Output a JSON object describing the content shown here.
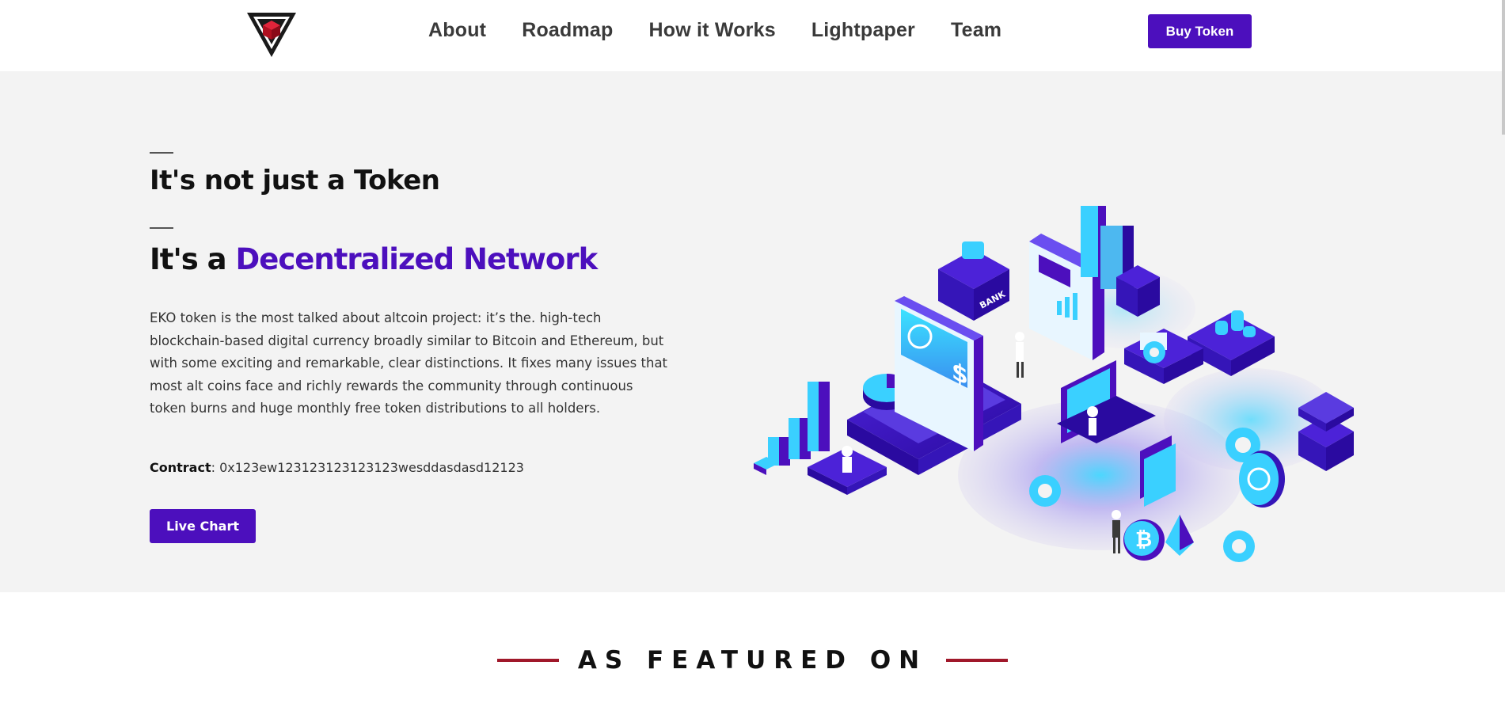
{
  "header": {
    "logo_icon": "triangle-cube-logo-icon",
    "nav": [
      "About",
      "Roadmap",
      "How it Works",
      "Lightpaper",
      "Team"
    ],
    "buy_label": "Buy Token"
  },
  "hero": {
    "title_line1": "It's not just a Token",
    "title_line2_black": "It's a ",
    "title_line2_purple": "Decentralized Network",
    "description": "EKO token is the most talked about altcoin project: it’s the. high-tech blockchain-based digital currency broadly similar to Bitcoin and Ethereum, but with some exciting and remarkable, clear distinctions. It fixes many issues that most alt coins face and richly rewards the community through continuous token burns and huge monthly free token distributions to all holders.",
    "contract_label": "Contract",
    "contract_value": ": 0x123ew123123123123123wesddasdasd12123",
    "live_chart_label": "Live Chart",
    "illustration_icon": "isometric-blockchain-illustration-icon"
  },
  "featured": {
    "title": "AS FEATURED ON"
  },
  "colors": {
    "brand_purple": "#4c0fbd",
    "accent_red": "#a0182a",
    "hero_bg": "#f3f3f3"
  }
}
